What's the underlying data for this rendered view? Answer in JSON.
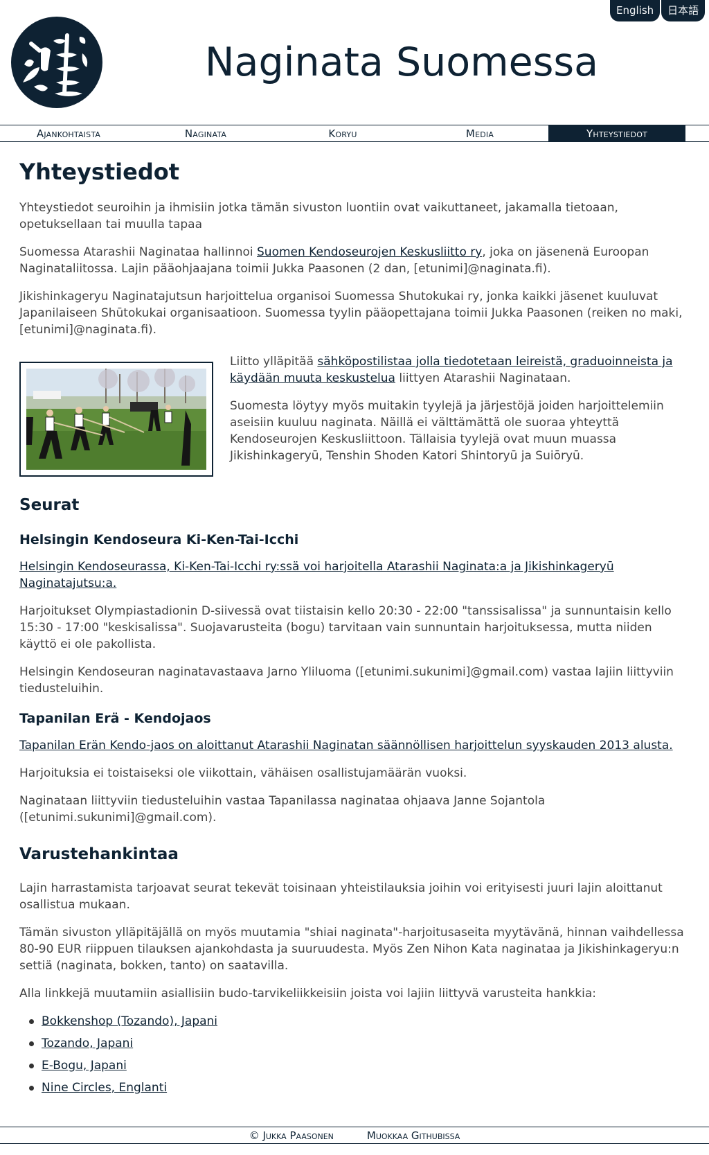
{
  "header": {
    "languages": [
      "English",
      "日本語"
    ],
    "site_title": "Naginata Suomessa"
  },
  "nav": {
    "items": [
      "Ajankohtaista",
      "Naginata",
      "Koryu",
      "Media",
      "Yhteystiedot"
    ],
    "active_index": 4
  },
  "page": {
    "title": "Yhteystiedot",
    "intro": "Yhteystiedot seuroihin ja ihmisiin jotka tämän sivuston luontiin ovat vaikuttaneet, jakamalla tietoaan, opetuksellaan tai muulla tapaa",
    "p2_before": "Suomessa Atarashii Naginataa hallinnoi ",
    "p2_link": "Suomen Kendoseurojen Keskusliitto ry",
    "p2_after": ", joka on jäsenenä Euroopan Naginataliitossa. Lajin pääohjaajana toimii Jukka Paasonen (2 dan, [etunimi]@naginata.fi).",
    "p3": "Jikishinkageryu Naginatajutsun harjoittelua organisoi Suomessa Shutokukai ry, jonka kaikki jäsenet kuuluvat Japanilaiseen Shūtokukai organisaatioon. Suomessa tyylin pääopettajana toimii Jukka Paasonen (reiken no maki, [etunimi]@naginata.fi).",
    "p4_before": "Liitto ylläpitää ",
    "p4_link": "sähköpostilistaa jolla tiedotetaan leireistä, graduoinneista ja käydään muuta keskustelua",
    "p4_after": " liittyen Atarashii Naginataan.",
    "p5": "Suomesta löytyy myös muitakin tyylejä ja järjestöjä joiden harjoittelemiin aseisiin kuuluu naginata. Näillä ei välttämättä ole suoraa yhteyttä Kendoseurojen Keskusliittoon. Tällaisia tyylejä ovat muun muassa Jikishinkageryū, Tenshin Shoden Katori Shintoryū ja Suiōryū."
  },
  "clubs": {
    "heading": "Seurat",
    "helsinki": {
      "heading": "Helsingin Kendoseura Ki-Ken-Tai-Icchi",
      "link": "Helsingin Kendoseurassa, Ki-Ken-Tai-Icchi ry:ssä voi harjoitella Atarashii Naginata:a ja Jikishinkageryū Naginatajutsu:a.",
      "p1": "Harjoitukset Olympiastadionin D-siivessä ovat tiistaisin kello 20:30 - 22:00 \"tanssisalissa\" ja sunnuntaisin kello 15:30 - 17:00 \"keskisalissa\". Suojavarusteita (bogu) tarvitaan vain sunnuntain harjoituksessa, mutta niiden käyttö ei ole pakollista.",
      "p2": "Helsingin Kendoseuran naginatavastaava Jarno Yliluoma ([etunimi.sukunimi]@gmail.com) vastaa lajiin liittyviin tiedusteluihin."
    },
    "tapanila": {
      "heading": "Tapanilan Erä - Kendojaos",
      "link": "Tapanilan Erän Kendo-jaos on aloittanut Atarashii Naginatan säännöllisen harjoittelun syyskauden 2013 alusta.",
      "p1": "Harjoituksia ei toistaiseksi ole viikottain, vähäisen osallistujamäärän vuoksi.",
      "p2": "Naginataan liittyviin tiedusteluihin vastaa Tapanilassa naginataa ohjaava Janne Sojantola ([etunimi.sukunimi]@gmail.com)."
    }
  },
  "equipment": {
    "heading": "Varustehankintaa",
    "p1": "Lajin harrastamista tarjoavat seurat tekevät toisinaan yhteistilauksia joihin voi erityisesti juuri lajin aloittanut osallistua mukaan.",
    "p2": "Tämän sivuston ylläpitäjällä on myös muutamia \"shiai naginata\"-harjoitusaseita myytävänä, hinnan vaihdellessa 80-90 EUR riippuen tilauksen ajankohdasta ja suuruudesta. Myös Zen Nihon Kata naginataa ja Jikishinkageryu:n settiä (naginata, bokken, tanto) on saatavilla.",
    "p3": "Alla linkkejä muutamiin asiallisiin budo-tarvikeliikkeisiin joista voi lajiin liittyvä varusteita hankkia:",
    "shops": [
      "Bokkenshop (Tozando), Japani",
      "Tozando, Japani",
      "E-Bogu, Japani",
      "Nine Circles, Englanti"
    ]
  },
  "footer": {
    "copyright": "© Jukka Paasonen",
    "edit": "Muokkaa Githubissa"
  },
  "colors": {
    "brand": "#0e2233",
    "text": "#444444"
  }
}
